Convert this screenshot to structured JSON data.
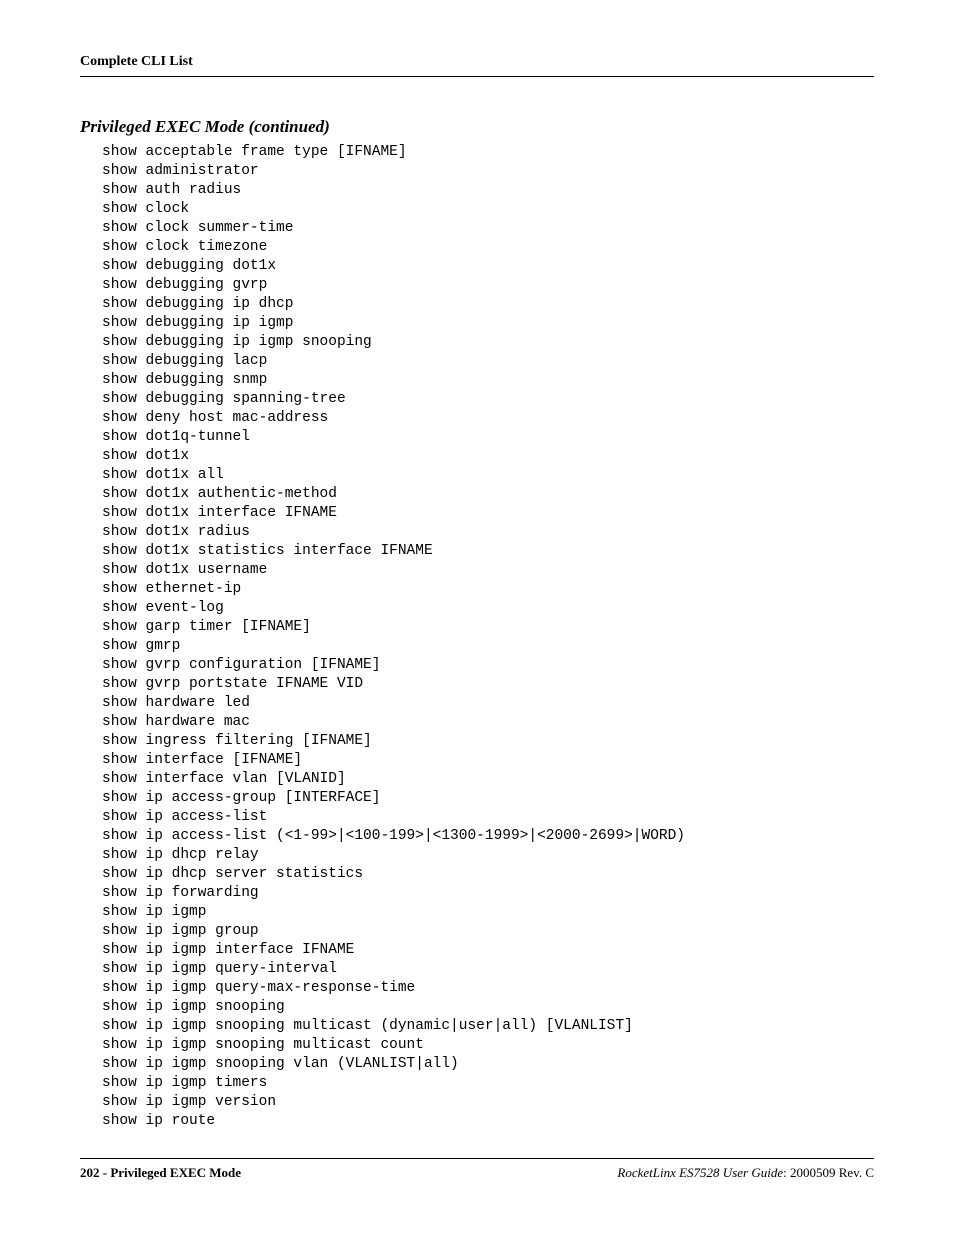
{
  "header": {
    "running_title": "Complete CLI List"
  },
  "section": {
    "title": "Privileged EXEC Mode (continued)"
  },
  "cli": {
    "lines": [
      "show acceptable frame type [IFNAME]",
      "show administrator",
      "show auth radius",
      "show clock",
      "show clock summer-time",
      "show clock timezone",
      "show debugging dot1x",
      "show debugging gvrp",
      "show debugging ip dhcp",
      "show debugging ip igmp",
      "show debugging ip igmp snooping",
      "show debugging lacp",
      "show debugging snmp",
      "show debugging spanning-tree",
      "show deny host mac-address",
      "show dot1q-tunnel",
      "show dot1x",
      "show dot1x all",
      "show dot1x authentic-method",
      "show dot1x interface IFNAME",
      "show dot1x radius",
      "show dot1x statistics interface IFNAME",
      "show dot1x username",
      "show ethernet-ip",
      "show event-log",
      "show garp timer [IFNAME]",
      "show gmrp",
      "show gvrp configuration [IFNAME]",
      "show gvrp portstate IFNAME VID",
      "show hardware led",
      "show hardware mac",
      "show ingress filtering [IFNAME]",
      "show interface [IFNAME]",
      "show interface vlan [VLANID]",
      "show ip access-group [INTERFACE]",
      "show ip access-list",
      "show ip access-list (<1-99>|<100-199>|<1300-1999>|<2000-2699>|WORD)",
      "show ip dhcp relay",
      "show ip dhcp server statistics",
      "show ip forwarding",
      "show ip igmp",
      "show ip igmp group",
      "show ip igmp interface IFNAME",
      "show ip igmp query-interval",
      "show ip igmp query-max-response-time",
      "show ip igmp snooping",
      "show ip igmp snooping multicast (dynamic|user|all) [VLANLIST]",
      "show ip igmp snooping multicast count",
      "show ip igmp snooping vlan (VLANLIST|all)",
      "show ip igmp timers",
      "show ip igmp version",
      "show ip route"
    ]
  },
  "footer": {
    "left": "202 - Privileged EXEC Mode",
    "product": "RocketLinx ES7528  User Guide",
    "rev": ": 2000509 Rev. C"
  }
}
